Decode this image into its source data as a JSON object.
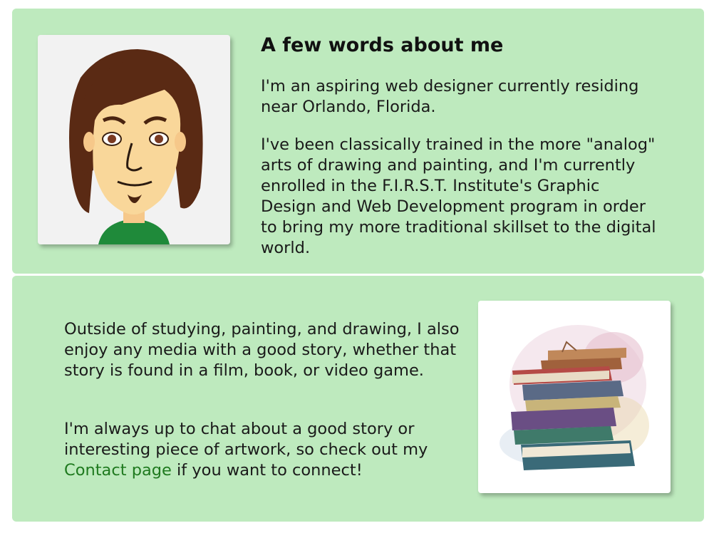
{
  "about": {
    "heading": "A few words about me",
    "intro": "I'm an aspiring web designer currently residing near Orlando, Florida.",
    "training": "I've been classically trained in the more \"analog\" arts of drawing and painting, and I'm currently enrolled in the F.I.R.S.T. Institute's Graphic Design and Web Development program in order to bring my more traditional skillset to the digital world.",
    "avatar_icon": "mii-avatar-portrait"
  },
  "hobbies": {
    "interests": "Outside of studying, painting, and drawing, I also enjoy any media with a good story, whether that story is found in a film, book, or video game.",
    "contact_prefix": "I'm always up to chat about a good story or interesting piece of artwork, so check out my ",
    "contact_link": "Contact page",
    "contact_suffix": " if you want to connect!",
    "books_icon": "watercolor-book-stack"
  },
  "colors": {
    "card_background": "#beeabe",
    "link": "#1f7a1f"
  }
}
